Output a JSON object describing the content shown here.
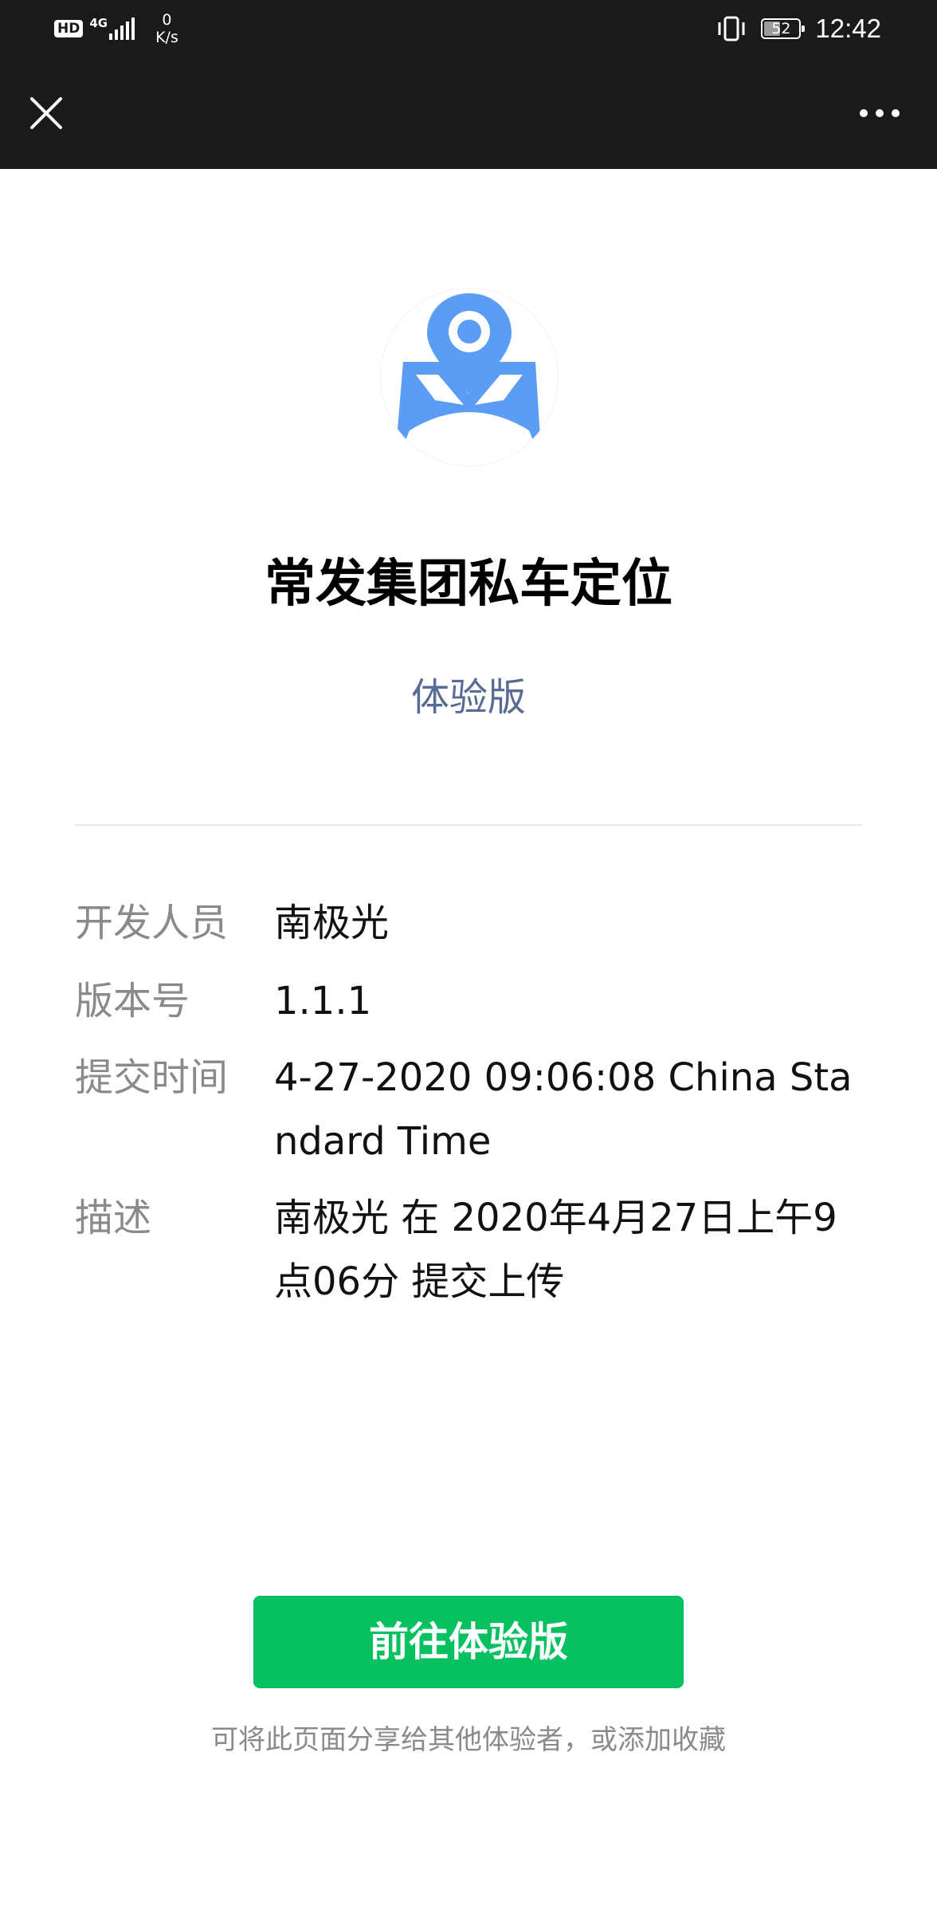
{
  "status_bar": {
    "hd_badge": "HD",
    "network_type": "4G",
    "speed_value": "0",
    "speed_unit": "K/s",
    "battery_level": 52,
    "battery_text": "52",
    "time": "12:42"
  },
  "nav": {
    "close_icon": "close-icon",
    "more_icon": "more-icon"
  },
  "app": {
    "logo_icon": "map-pin-icon",
    "logo_color": "#5b9cf5",
    "name": "常发集团私车定位",
    "version_type": "体验版",
    "version_type_color": "#576b95"
  },
  "info": {
    "developer_label": "开发人员",
    "developer_value": "南极光",
    "version_label": "版本号",
    "version_value": "1.1.1",
    "submit_time_label": "提交时间",
    "submit_time_value": "4-27-2020 09:06:08 China Standard Time",
    "description_label": "描述",
    "description_value": "南极光 在 2020年4月27日上午9点06分 提交上传"
  },
  "actions": {
    "primary_label": "前往体验版",
    "primary_color": "#07c160",
    "hint": "可将此页面分享给其他体验者，或添加收藏"
  }
}
